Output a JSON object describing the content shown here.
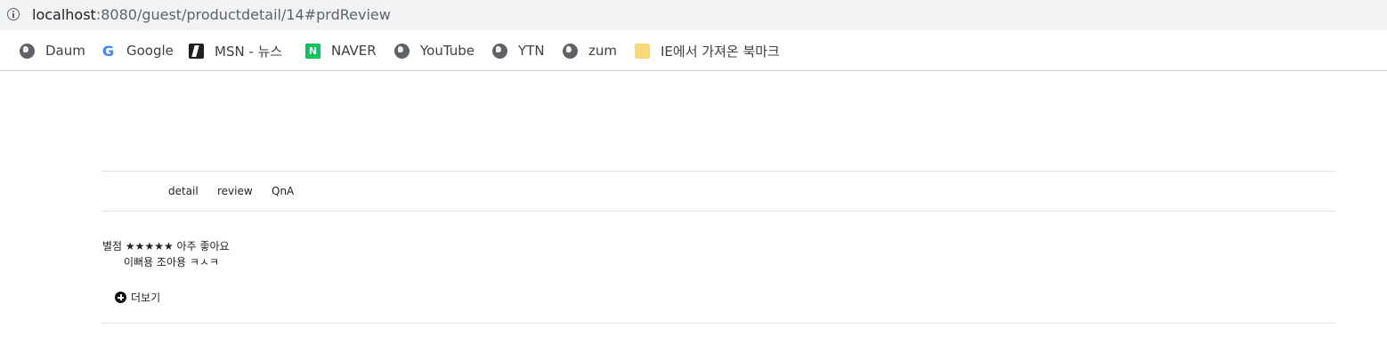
{
  "address_bar": {
    "url_host": "localhost",
    "url_rest": ":8080/guest/productdetail/14#prdReview"
  },
  "bookmarks": [
    {
      "label": "Daum",
      "icon": "globe-icon"
    },
    {
      "label": "Google",
      "icon": "google-icon",
      "glyph": "G"
    },
    {
      "label": "MSN - 뉴스",
      "icon": "msn-icon"
    },
    {
      "label": "NAVER",
      "icon": "naver-icon",
      "glyph": "N"
    },
    {
      "label": "YouTube",
      "icon": "globe-icon"
    },
    {
      "label": "YTN",
      "icon": "globe-icon"
    },
    {
      "label": "zum",
      "icon": "globe-icon"
    },
    {
      "label": "IE에서 가져온 북마크",
      "icon": "folder-icon"
    }
  ],
  "product_tabs": [
    {
      "label": "detail"
    },
    {
      "label": "review"
    },
    {
      "label": "QnA"
    }
  ],
  "review": {
    "rating_label": "별점",
    "stars": "★★★★★",
    "rating_text": "아주 좋아요",
    "rating_value": 5,
    "rating_max": 5,
    "content": "이뻐용 조아용 ㅋㅅㅋ"
  },
  "more_button": {
    "label": "더보기",
    "icon": "plus-circle-icon"
  },
  "colors": {
    "address_bar_bg": "#f1f3f4",
    "naver_green": "#03c75a",
    "google_blue": "#4285f4",
    "folder_yellow": "#f9d976",
    "rule": "#e3e3e3"
  }
}
